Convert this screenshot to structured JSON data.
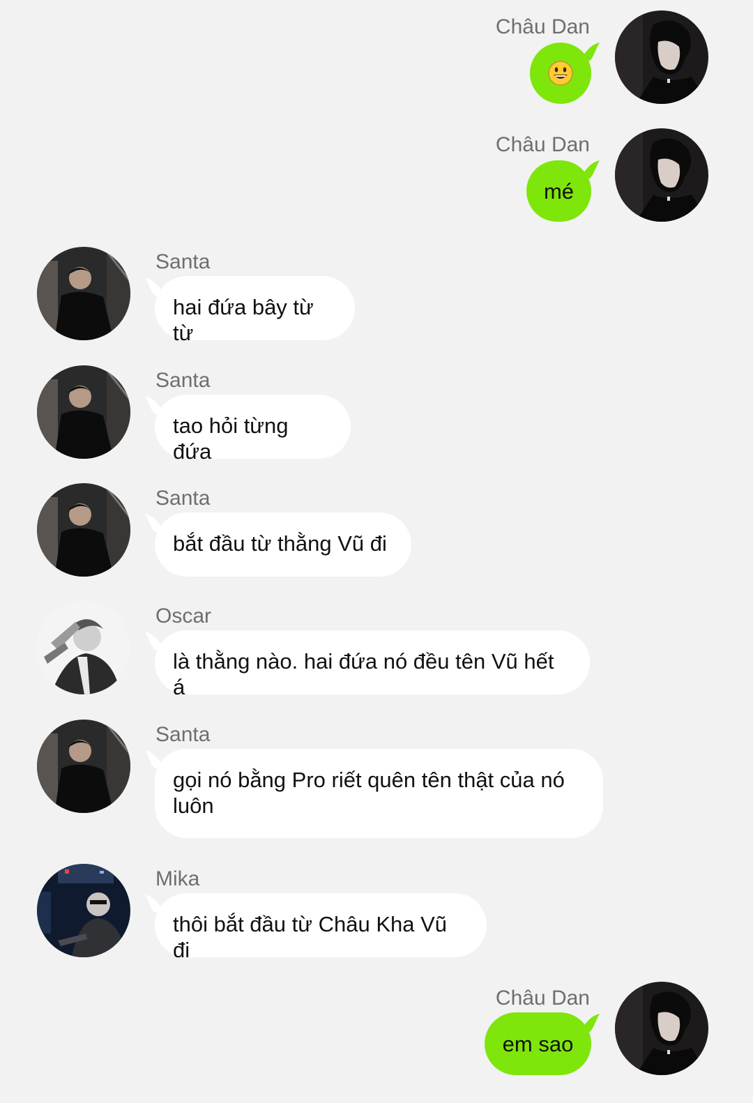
{
  "messages": [
    {
      "sender": "Châu Dan",
      "direction": "out",
      "text": "",
      "emoji": "😃"
    },
    {
      "sender": "Châu Dan",
      "direction": "out",
      "text": "mé"
    },
    {
      "sender": "Santa",
      "direction": "in",
      "text": "hai đứa bây từ từ"
    },
    {
      "sender": "Santa",
      "direction": "in",
      "text": "tao hỏi từng đứa"
    },
    {
      "sender": "Santa",
      "direction": "in",
      "text": "bắt đầu từ thằng Vũ đi"
    },
    {
      "sender": "Oscar",
      "direction": "in",
      "text": "là thằng nào. hai đứa nó đều tên Vũ hết á"
    },
    {
      "sender": "Santa",
      "direction": "in",
      "text": "gọi nó bằng Pro riết quên tên thật của nó luôn"
    },
    {
      "sender": "Mika",
      "direction": "in",
      "text": "thôi bắt đầu từ Châu Kha Vũ đi"
    },
    {
      "sender": "Châu Dan",
      "direction": "out",
      "text": "em sao"
    }
  ],
  "colors": {
    "background": "#f2f2f2",
    "outgoing_bubble": "#7ee60a",
    "incoming_bubble": "#ffffff",
    "sender_name": "#6e6e6e"
  },
  "icons": {
    "smiley": "grinning-face-emoji",
    "avatars": [
      "chau-dan-avatar",
      "santa-avatar",
      "oscar-avatar",
      "mika-avatar"
    ]
  }
}
